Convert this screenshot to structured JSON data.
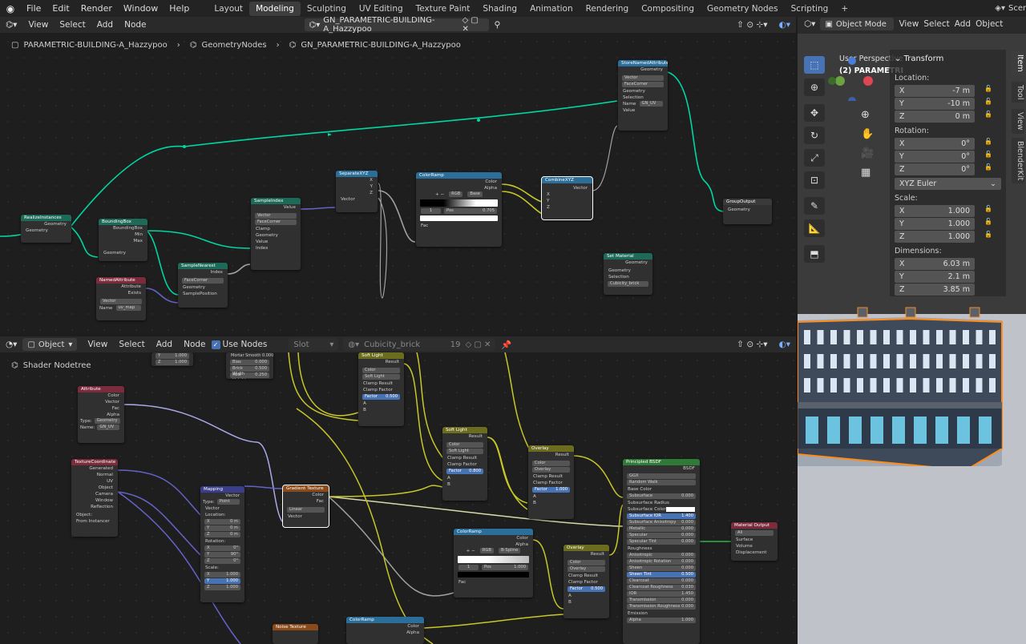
{
  "topbar": {
    "menus": [
      "File",
      "Edit",
      "Render",
      "Window",
      "Help"
    ],
    "workspaces": [
      "Layout",
      "Modeling",
      "Sculpting",
      "UV Editing",
      "Texture Paint",
      "Shading",
      "Animation",
      "Rendering",
      "Compositing",
      "Geometry Nodes",
      "Scripting"
    ],
    "active_workspace": "Modeling",
    "scene": "Scene"
  },
  "gn_header": {
    "view": "View",
    "select": "Select",
    "add": "Add",
    "node": "Node",
    "tree_name": "GN_PARAMETRIC-BUILDING-A_Hazzypoo"
  },
  "gn_breadcrumb": {
    "object": "PARAMETRIC-BUILDING-A_Hazzypoo",
    "modifier": "GeometryNodes",
    "tree": "GN_PARAMETRIC-BUILDING-A_Hazzypoo"
  },
  "gn_nodes": {
    "realize": {
      "title": "RealizeInstances",
      "out": "Geometry",
      "in": "Geometry"
    },
    "bbox": {
      "title": "BoundingBox",
      "out1": "BoundingBox",
      "out2": "Min",
      "out3": "Max",
      "in": "Geometry"
    },
    "named": {
      "title": "NamedAttribute",
      "out1": "Attribute",
      "out2": "Exists",
      "type": "Vector",
      "name_lbl": "Name",
      "name_val": "uv_map"
    },
    "nearest": {
      "title": "SampleNearest",
      "out": "Index",
      "domain": "FaceCorner",
      "in1": "Geometry",
      "in2": "SamplePosition"
    },
    "sampleidx": {
      "title": "SampleIndex",
      "out": "Value",
      "type": "Vector",
      "domain": "FaceCorner",
      "clamp": "Clamp",
      "in1": "Geometry",
      "in2": "Value",
      "in3": "Index"
    },
    "sepxyz": {
      "title": "SeparateXYZ",
      "x": "X",
      "y": "Y",
      "z": "Z",
      "in": "Vector"
    },
    "colorramp": {
      "title": "ColorRamp",
      "out1": "Color",
      "out2": "Alpha",
      "mode": "RGB",
      "interp": "Base",
      "idx": "1",
      "pos_lbl": "Pos",
      "pos_val": "0.705",
      "in": "Fac"
    },
    "combxyz": {
      "title": "CombineXYZ",
      "out": "Vector",
      "x": "X",
      "y": "Y",
      "z": "Z"
    },
    "store": {
      "title": "StoreNamedAttribute",
      "out": "Geometry",
      "type": "Vector",
      "domain": "FaceCorner",
      "in1": "Geometry",
      "in2": "Selection",
      "name_lbl": "Name",
      "name_val": "GN_UV",
      "in3": "Value"
    },
    "groupout": {
      "title": "GroupOutput",
      "in": "Geometry"
    },
    "setmat": {
      "title": "Set Material",
      "out": "Geometry",
      "in1": "Geometry",
      "in2": "Selection",
      "mat": "Cubicity_brick"
    }
  },
  "sh_header": {
    "editor": "Object",
    "view": "View",
    "select": "Select",
    "add": "Add",
    "node": "Node",
    "use_nodes": "Use Nodes",
    "slot": "Slot",
    "material": "Cubicity_brick",
    "users": "19",
    "tree_label": "Shader Nodetree"
  },
  "sh_nodes": {
    "topleft": {
      "y": "Y",
      "yv": "1.000",
      "z": "Z",
      "zv": "1.000"
    },
    "brick": {
      "r1": "Mortar Smooth 0.000",
      "r2": "Bias",
      "r2v": "0.000",
      "r3": "Brick Width",
      "r3v": "0.500",
      "r4": "Row Height",
      "r4v": "0.250"
    },
    "attr": {
      "title": "Attribute",
      "o1": "Color",
      "o2": "Vector",
      "o3": "Fac",
      "o4": "Alpha",
      "type_lbl": "Type:",
      "type": "Geometry",
      "name_lbl": "Name:",
      "name": "GN_UV"
    },
    "texcoord": {
      "title": "TextureCoordinate",
      "o1": "Generated",
      "o2": "Normal",
      "o3": "UV",
      "o4": "Object",
      "o5": "Camera",
      "o6": "Window",
      "o7": "Reflection",
      "obj": "Object:",
      "inst": "From Instancer"
    },
    "mapping": {
      "title": "Mapping",
      "out": "Vector",
      "type_lbl": "Type:",
      "type": "Point",
      "vec": "Vector",
      "loc": "Location:",
      "x": "X",
      "y": "Y",
      "z": "Z",
      "lx": "0 m",
      "ly": "0 m",
      "lz": "0 m",
      "rot": "Rotation:",
      "rx": "0°",
      "ry": "90°",
      "rz": "0°",
      "scale": "Scale:",
      "sx": "1.000",
      "sy": "1.000",
      "sz": "1.000"
    },
    "gradient": {
      "title": "Gradient Texture",
      "o1": "Color",
      "o2": "Fac",
      "type": "Linear",
      "in": "Vector"
    },
    "soft1": {
      "title": "Soft Light",
      "out": "Result",
      "t1": "Color",
      "t2": "Soft Light",
      "c1": "Clamp Result",
      "c2": "Clamp Factor",
      "fac": "Factor",
      "facv": "0.500",
      "a": "A",
      "b": "B"
    },
    "soft2": {
      "title": "Soft Light",
      "out": "Result",
      "t1": "Color",
      "t2": "Soft Light",
      "c1": "Clamp Result",
      "c2": "Clamp Factor",
      "fac": "Factor",
      "facv": "0.800",
      "a": "A",
      "b": "B"
    },
    "overlay1": {
      "title": "Overlay",
      "out": "Result",
      "t1": "Color",
      "t2": "Overlay",
      "c1": "Clamp Result",
      "c2": "Clamp Factor",
      "fac": "Factor",
      "facv": "1.000",
      "a": "A",
      "b": "B"
    },
    "ramp2": {
      "title": "ColorRamp",
      "o1": "Color",
      "o2": "Alpha",
      "mode": "RGB",
      "interp": "B-Spline",
      "idx": "1",
      "pos": "Pos",
      "posv": "1.000",
      "in": "Fac"
    },
    "overlay2": {
      "title": "Overlay",
      "out": "Result",
      "t1": "Color",
      "t2": "Overlay",
      "c1": "Clamp Result",
      "c2": "Clamp Factor",
      "fac": "Factor",
      "facv": "0.500",
      "a": "A",
      "b": "B"
    },
    "bsdf": {
      "title": "Principled BSDF",
      "out": "BSDF",
      "m1": "GGX",
      "m2": "Random Walk",
      "rows": [
        [
          "Base Color",
          ""
        ],
        [
          "Subsurface",
          "0.000"
        ],
        [
          "Subsurface Radius",
          ""
        ],
        [
          "Subsurface Color",
          ""
        ],
        [
          "Subsurface IOR",
          "1.400"
        ],
        [
          "Subsurface Anisotropy",
          "0.000"
        ],
        [
          "Metallic",
          "0.000"
        ],
        [
          "Specular",
          "0.000"
        ],
        [
          "Specular Tint",
          "0.000"
        ],
        [
          "Roughness",
          ""
        ],
        [
          "Anisotropic",
          "0.000"
        ],
        [
          "Anisotropic Rotation",
          "0.000"
        ],
        [
          "Sheen",
          "0.000"
        ],
        [
          "Sheen Tint",
          "0.500"
        ],
        [
          "Clearcoat",
          "0.000"
        ],
        [
          "Clearcoat Roughness",
          "0.030"
        ],
        [
          "IOR",
          "1.450"
        ],
        [
          "Transmission",
          "0.000"
        ],
        [
          "Transmission Roughness",
          "0.000"
        ],
        [
          "Emission",
          ""
        ],
        [
          "Alpha",
          "1.000"
        ]
      ]
    },
    "matout": {
      "title": "Material Output",
      "target": "All",
      "i1": "Surface",
      "i2": "Volume",
      "i3": "Displacement"
    },
    "noise": {
      "title": "Noise Texture"
    },
    "ramp3": {
      "title": "ColorRamp",
      "o1": "Color",
      "o2": "Alpha"
    }
  },
  "viewport": {
    "mode": "Object Mode",
    "view": "View",
    "select": "Select",
    "add": "Add",
    "object": "Object",
    "overlay1": "User Perspective",
    "overlay2": "(2) PARAMETRI"
  },
  "npanel": {
    "title": "Transform",
    "location": "Location:",
    "loc": [
      [
        "X",
        "-7 m"
      ],
      [
        "Y",
        "-10 m"
      ],
      [
        "Z",
        "0 m"
      ]
    ],
    "rotation": "Rotation:",
    "rot": [
      [
        "X",
        "0°"
      ],
      [
        "Y",
        "0°"
      ],
      [
        "Z",
        "0°"
      ]
    ],
    "euler": "XYZ Euler",
    "scale": "Scale:",
    "scl": [
      [
        "X",
        "1.000"
      ],
      [
        "Y",
        "1.000"
      ],
      [
        "Z",
        "1.000"
      ]
    ],
    "dimensions": "Dimensions:",
    "dim": [
      [
        "X",
        "6.03 m"
      ],
      [
        "Y",
        "2.1 m"
      ],
      [
        "Z",
        "3.85 m"
      ]
    ]
  },
  "ntabs": [
    "Item",
    "Tool",
    "View",
    "BlenderKit"
  ],
  "colors": {
    "geo_wire": "#00d6a3",
    "vec_wire": "#6363c7",
    "float_wire": "#a1a1a1",
    "color_wire": "#c7c729",
    "select": "#4772b3"
  }
}
